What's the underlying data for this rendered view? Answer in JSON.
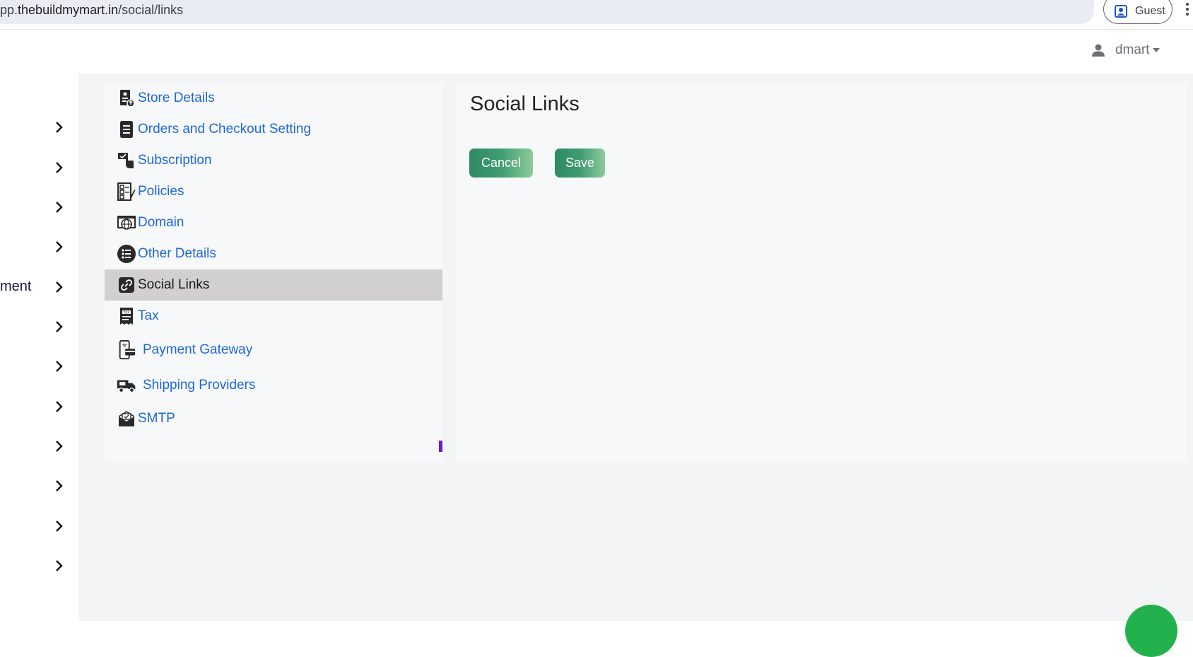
{
  "browser": {
    "url_prefix": "pp.",
    "url_host": "thebuildmymart.in",
    "url_path": "/social/links",
    "profile_label": "Guest"
  },
  "header": {
    "user_name": "dmart"
  },
  "left_nav": {
    "partial_label": "ment"
  },
  "settings_menu": {
    "items": [
      {
        "label": "Store Details",
        "icon": "store-details-icon"
      },
      {
        "label": "Orders and Checkout Setting",
        "icon": "orders-document-icon"
      },
      {
        "label": "Subscription",
        "icon": "subscription-hand-icon"
      },
      {
        "label": "Policies",
        "icon": "policies-checklist-icon"
      },
      {
        "label": "Domain",
        "icon": "domain-globe-icon"
      },
      {
        "label": "Other Details",
        "icon": "list-circle-icon"
      },
      {
        "label": "Social Links",
        "icon": "link-icon",
        "active": true
      },
      {
        "label": "Tax",
        "icon": "tax-receipt-icon"
      },
      {
        "label": "Payment Gateway",
        "icon": "payment-phone-icon"
      },
      {
        "label": "Shipping Providers",
        "icon": "delivery-truck-icon"
      },
      {
        "label": "SMTP",
        "icon": "mail-tray-icon"
      }
    ]
  },
  "content": {
    "title": "Social Links",
    "cancel_label": "Cancel",
    "save_label": "Save"
  },
  "colors": {
    "link_blue": "#1f66d9",
    "active_bg": "#d1cfd0",
    "button_green": "#2f8a65",
    "chat_green": "#22b14c"
  }
}
